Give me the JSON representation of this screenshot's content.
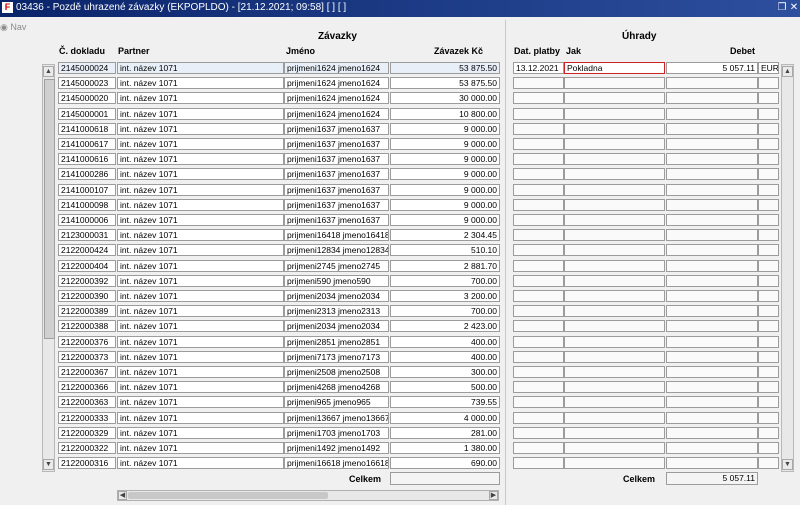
{
  "window": {
    "title": "03436 - Pozdě uhrazené závazky (EKPOPLDO) - [21.12.2021; 09:58]  [ ] [ ]",
    "restore_glyph": "❐",
    "close_glyph": "✕"
  },
  "nav": {
    "label": "Nav"
  },
  "zavazky": {
    "header": "Závazky",
    "columns": {
      "doklad": "Č. dokladu",
      "partner": "Partner",
      "jmeno": "Jméno",
      "castka": "Závazek Kč"
    },
    "rows": [
      [
        "2145000024",
        "int. název 1071",
        "prijmeni1624 jmeno1624",
        "53 875.50"
      ],
      [
        "2145000023",
        "int. název 1071",
        "prijmeni1624 jmeno1624",
        "53 875.50"
      ],
      [
        "2145000020",
        "int. název 1071",
        "prijmeni1624 jmeno1624",
        "30 000.00"
      ],
      [
        "2145000001",
        "int. název 1071",
        "prijmeni1624 jmeno1624",
        "10 800.00"
      ],
      [
        "2141000618",
        "int. název 1071",
        "prijmeni1637 jmeno1637",
        "9 000.00"
      ],
      [
        "2141000617",
        "int. název 1071",
        "prijmeni1637 jmeno1637",
        "9 000.00"
      ],
      [
        "2141000616",
        "int. název 1071",
        "prijmeni1637 jmeno1637",
        "9 000.00"
      ],
      [
        "2141000286",
        "int. název 1071",
        "prijmeni1637 jmeno1637",
        "9 000.00"
      ],
      [
        "2141000107",
        "int. název 1071",
        "prijmeni1637 jmeno1637",
        "9 000.00"
      ],
      [
        "2141000098",
        "int. název 1071",
        "prijmeni1637 jmeno1637",
        "9 000.00"
      ],
      [
        "2141000006",
        "int. název 1071",
        "prijmeni1637 jmeno1637",
        "9 000.00"
      ],
      [
        "2123000031",
        "int. název 1071",
        "prijmeni16418 jmeno16418",
        "2 304.45"
      ],
      [
        "2122000424",
        "int. název 1071",
        "prijmeni12834 jmeno12834",
        "510.10"
      ],
      [
        "2122000404",
        "int. název 1071",
        "prijmeni2745 jmeno2745",
        "2 881.70"
      ],
      [
        "2122000392",
        "int. název 1071",
        "prijmeni590 jmeno590",
        "700.00"
      ],
      [
        "2122000390",
        "int. název 1071",
        "prijmeni2034 jmeno2034",
        "3 200.00"
      ],
      [
        "2122000389",
        "int. název 1071",
        "prijmeni2313 jmeno2313",
        "700.00"
      ],
      [
        "2122000388",
        "int. název 1071",
        "prijmeni2034 jmeno2034",
        "2 423.00"
      ],
      [
        "2122000376",
        "int. název 1071",
        "prijmeni2851 jmeno2851",
        "400.00"
      ],
      [
        "2122000373",
        "int. název 1071",
        "prijmeni7173 jmeno7173",
        "400.00"
      ],
      [
        "2122000367",
        "int. název 1071",
        "prijmeni2508 jmeno2508",
        "300.00"
      ],
      [
        "2122000366",
        "int. název 1071",
        "prijmeni4268 jmeno4268",
        "500.00"
      ],
      [
        "2122000363",
        "int. název 1071",
        "prijmeni965 jmeno965",
        "739.55"
      ],
      [
        "2122000333",
        "int. název 1071",
        "prijmeni13667 jmeno13667",
        "4 000.00"
      ],
      [
        "2122000329",
        "int. název 1071",
        "prijmeni1703 jmeno1703",
        "281.00"
      ],
      [
        "2122000322",
        "int. název 1071",
        "prijmeni1492 jmeno1492",
        "1 380.00"
      ],
      [
        "2122000316",
        "int. název 1071",
        "prijmeni16618 jmeno16618",
        "690.00"
      ]
    ],
    "total_label": "Celkem",
    "total_value": ""
  },
  "uhrady": {
    "header": "Úhrady",
    "columns": {
      "datum": "Dat. platby",
      "jak": "Jak",
      "debet": "Debet"
    },
    "first_row": {
      "datum": "13.12.2021",
      "jak": "Pokladna",
      "debet": "5 057.11",
      "mena": "EUR"
    },
    "total_label": "Celkem",
    "total_value": "5 057.11"
  },
  "icons": {
    "scroll_up": "▲",
    "scroll_down": "▼",
    "scroll_left": "◀",
    "scroll_right": "▶"
  }
}
